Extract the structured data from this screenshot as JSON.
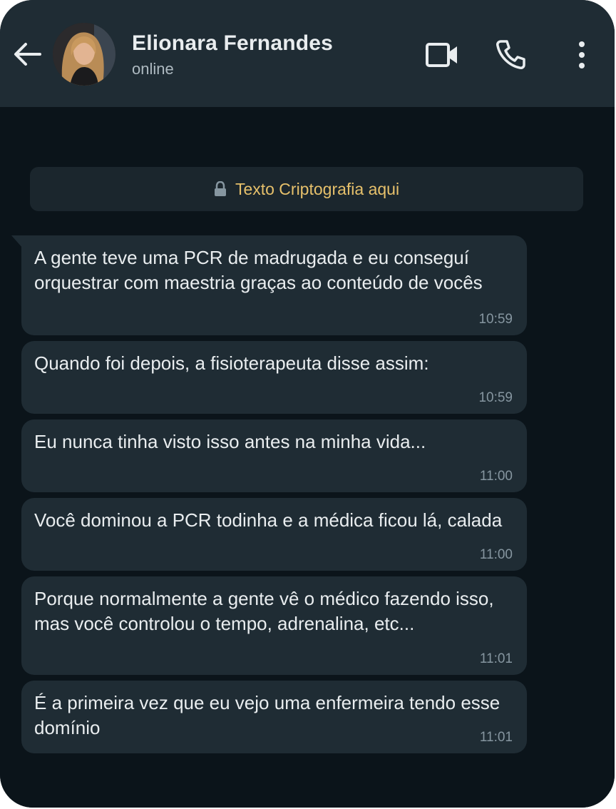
{
  "header": {
    "contact_name": "Elionara Fernandes",
    "status": "online",
    "icons": [
      "back-arrow-icon",
      "avatar",
      "video-call-icon",
      "phone-icon",
      "more-options-icon"
    ]
  },
  "encryption_notice": {
    "text": "Texto Criptografia aqui",
    "icon": "lock-icon"
  },
  "messages": [
    {
      "text": "A gente teve uma PCR de madrugada e eu conseguí orquestrar com maestria graças ao conteúdo de vocês",
      "time": "10:59"
    },
    {
      "text": "Quando foi depois, a fisioterapeuta disse assim:",
      "time": "10:59"
    },
    {
      "text": "Eu nunca tinha visto isso antes na minha vida...",
      "time": "11:00"
    },
    {
      "text": "Você dominou a PCR todinha e a médica ficou lá, calada",
      "time": "11:00"
    },
    {
      "text": "Porque normalmente a gente vê o médico fazendo isso, mas você controlou o tempo, adrenalina, etc...",
      "time": "11:01"
    },
    {
      "text": "É a primeira vez que eu vejo uma enfermeira tendo esse domínio",
      "time": "11:01"
    }
  ],
  "colors": {
    "header_bg": "#1f2c34",
    "chat_bg": "#0b141a",
    "bubble_bg": "#1f2c34",
    "encryption_text": "#e6c06b",
    "timestamp": "#8696a0"
  }
}
